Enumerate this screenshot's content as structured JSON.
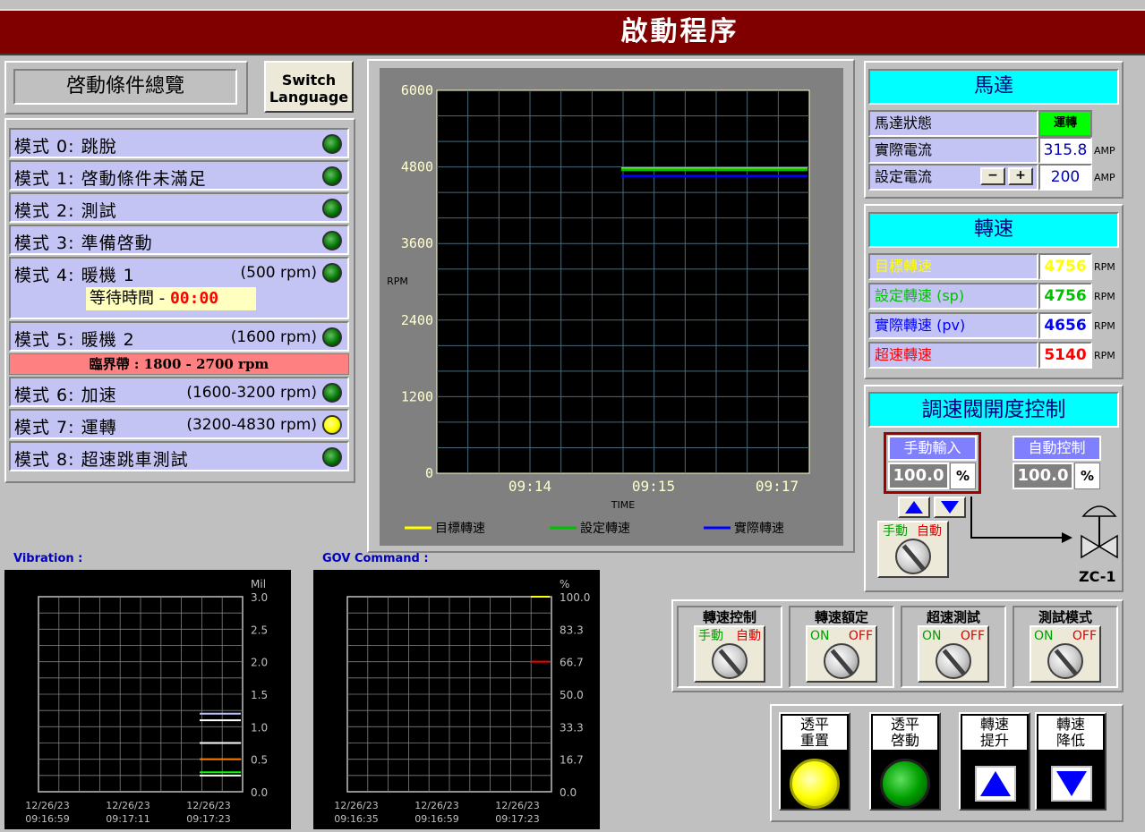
{
  "header": {
    "title": "啟動程序"
  },
  "overview": {
    "title": "啓動條件總覽",
    "switch_lang_line1": "Switch",
    "switch_lang_line2": "Language"
  },
  "modes": [
    {
      "label": "模式 0: 跳脫",
      "rpm": "",
      "led": "green"
    },
    {
      "label": "模式 1: 啓動條件未滿足",
      "rpm": "",
      "led": "green"
    },
    {
      "label": "模式 2: 測試",
      "rpm": "",
      "led": "green"
    },
    {
      "label": "模式 3: 準備啓動",
      "rpm": "",
      "led": "green"
    },
    {
      "label": "模式 4: 暖機 1",
      "rpm": "(500 rpm)",
      "led": "green"
    },
    {
      "label": "模式 5: 暖機 2",
      "rpm": "(1600 rpm)",
      "led": "green"
    },
    {
      "label": "模式 6: 加速",
      "rpm": "(1600-3200 rpm)",
      "led": "green"
    },
    {
      "label": "模式 7: 運轉",
      "rpm": "(3200-4830 rpm)",
      "led": "yellow"
    },
    {
      "label": "模式 8: 超速跳車測試",
      "rpm": "",
      "led": "green"
    }
  ],
  "wait": {
    "label": "等待時間 -",
    "time": "00:00"
  },
  "critical_band": "臨界帶 : 1800 - 2700 rpm",
  "main_chart": {
    "ylabel": "RPM",
    "xlabel": "TIME",
    "yticks": [
      "6000",
      "4800",
      "3600",
      "2400",
      "1200",
      "0"
    ],
    "xticks": [
      "09:14",
      "09:15",
      "09:17"
    ],
    "legend": [
      "目標轉速",
      "設定轉速",
      "實際轉速"
    ],
    "colors": [
      "#ffff00",
      "#00c000",
      "#0000ff"
    ]
  },
  "chart_data": [
    {
      "type": "line",
      "title": "",
      "xlabel": "TIME",
      "ylabel": "RPM",
      "ylim": [
        0,
        6000
      ],
      "x": [
        "09:14",
        "09:15",
        "09:17"
      ],
      "grid": true,
      "legend": "bottom",
      "series": [
        {
          "name": "目標轉速",
          "values": [
            null,
            4756,
            4756
          ]
        },
        {
          "name": "設定轉速",
          "values": [
            null,
            4756,
            4756
          ]
        },
        {
          "name": "實際轉速",
          "values": [
            null,
            4656,
            4656
          ]
        }
      ]
    },
    {
      "type": "line",
      "title": "Vibration :",
      "ylabel": "Mil",
      "ylim": [
        0,
        3
      ],
      "yticks": [
        "3.0",
        "2.5",
        "2.0",
        "1.5",
        "1.0",
        "0.5",
        "0.0"
      ],
      "x": [
        "12/26/23 09:16:59",
        "12/26/23 09:17:11",
        "12/26/23 09:17:23"
      ],
      "grid": true,
      "series": [
        {
          "values": [
            1.2
          ]
        },
        {
          "values": [
            1.1
          ]
        },
        {
          "values": [
            0.75
          ]
        },
        {
          "values": [
            0.5
          ]
        },
        {
          "values": [
            0.3
          ]
        },
        {
          "values": [
            0.25
          ]
        }
      ]
    },
    {
      "type": "line",
      "title": "GOV Command :",
      "ylabel": "%",
      "ylim": [
        0,
        100
      ],
      "yticks": [
        "100.0",
        "83.3",
        "66.7",
        "50.0",
        "33.3",
        "16.7",
        "0.0"
      ],
      "x": [
        "12/26/23 09:16:35",
        "12/26/23 09:16:59",
        "12/26/23 09:17:23"
      ],
      "grid": true,
      "series": [
        {
          "values": [
            100
          ]
        },
        {
          "values": [
            66.7
          ]
        }
      ]
    }
  ],
  "vib": {
    "title": "Vibration :",
    "unit": "Mil",
    "yticks": [
      "3.0",
      "2.5",
      "2.0",
      "1.5",
      "1.0",
      "0.5",
      "0.0"
    ],
    "xticks": [
      [
        "12/26/23",
        "09:16:59"
      ],
      [
        "12/26/23",
        "09:17:11"
      ],
      [
        "12/26/23",
        "09:17:23"
      ]
    ]
  },
  "gov": {
    "title": "GOV Command :",
    "unit": "%",
    "yticks": [
      "100.0",
      "83.3",
      "66.7",
      "50.0",
      "33.3",
      "16.7",
      "0.0"
    ],
    "xticks": [
      [
        "12/26/23",
        "09:16:35"
      ],
      [
        "12/26/23",
        "09:16:59"
      ],
      [
        "12/26/23",
        "09:17:23"
      ]
    ]
  },
  "motor": {
    "title": "馬達",
    "status_label": "馬達狀態",
    "status_value": "運轉",
    "actual_current_label": "實際電流",
    "actual_current": "315.8",
    "set_current_label": "設定電流",
    "set_current": "200",
    "unit": "AMP",
    "minus": "−",
    "plus": "+"
  },
  "speed": {
    "title": "轉速",
    "unit": "RPM",
    "rows": [
      {
        "label": "目標轉速",
        "value": "4756",
        "color": "#ffff00"
      },
      {
        "label": "設定轉速 (sp)",
        "value": "4756",
        "color": "#00c000"
      },
      {
        "label": "實際轉速 (pv)",
        "value": "4656",
        "color": "#0000ff"
      },
      {
        "label": "超速轉速",
        "value": "5140",
        "color": "#ff0000"
      }
    ]
  },
  "gov_control": {
    "title": "調速閥開度控制",
    "manual_label": "手動輸入",
    "manual_value": "100.0",
    "auto_label": "自動控制",
    "auto_value": "100.0",
    "pct": "%",
    "sw_manual": "手動",
    "sw_auto": "自動",
    "valve_id": "ZC-1"
  },
  "switches": [
    {
      "title": "轉速控制",
      "left": "手動",
      "right": "自動"
    },
    {
      "title": "轉速額定",
      "left": "ON",
      "right": "OFF"
    },
    {
      "title": "超速測試",
      "left": "ON",
      "right": "OFF"
    },
    {
      "title": "測試模式",
      "left": "ON",
      "right": "OFF"
    }
  ],
  "push_buttons": [
    {
      "l1": "透平",
      "l2": "重置"
    },
    {
      "l1": "透平",
      "l2": "啓動"
    },
    {
      "l1": "轉速",
      "l2": "提升"
    },
    {
      "l1": "轉速",
      "l2": "降低"
    }
  ]
}
